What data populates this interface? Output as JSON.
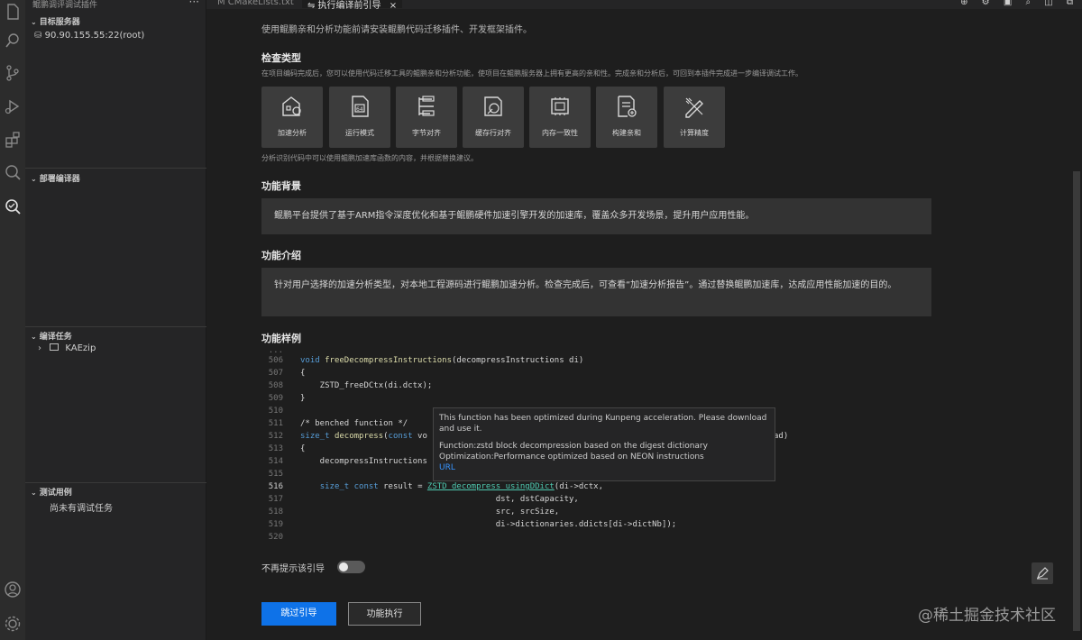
{
  "sidebar": {
    "title": "鲲鹏调评调试插件",
    "more": "···",
    "target_server_section": "目标服务器",
    "server_item": "90.90.155.55:22(root)",
    "deploy_section": "部署编译器",
    "compile_section": "编译任务",
    "compile_item": "KAEzip",
    "test_section": "测试用例",
    "test_empty": "尚未有调试任务"
  },
  "tabs": [
    {
      "label": "M CMakeLists.txt"
    },
    {
      "label": "⇋ 执行编译前引导",
      "close": "×"
    }
  ],
  "titlebar_icons": "⊕ ⚙ ▣ ⌕ ◫ ⧉",
  "main": {
    "intro": "使用鲲鹏亲和分析功能前请安装鲲鹏代码迁移插件、开发框架插件。",
    "check_type_title": "检查类型",
    "check_type_desc": "在项目编码完成后，您可以使用代码迁移工具的鲲鹏亲和分析功能，使项目在鲲鹏服务器上拥有更高的亲和性。完成亲和分析后，可回到本插件完成进一步编译调试工作。",
    "cards": [
      {
        "label": "加速分析",
        "icon": "building-gear-icon"
      },
      {
        "label": "运行模式",
        "icon": "document-64-icon"
      },
      {
        "label": "字节对齐",
        "icon": "align-list-icon"
      },
      {
        "label": "缓存行对齐",
        "icon": "gauge-doc-icon"
      },
      {
        "label": "内存一致性",
        "icon": "memory-icon"
      },
      {
        "label": "构建亲和",
        "icon": "doc-add-icon"
      },
      {
        "label": "计算精度",
        "icon": "pencil-ruler-icon"
      }
    ],
    "cards_note": "分析识别代码中可以使用鲲鹏加速库函数的内容，并根据替换建议。",
    "background_title": "功能背景",
    "background_text": "鲲鹏平台提供了基于ARM指令深度优化和基于鲲鹏硬件加速引擎开发的加速库，覆盖众多开发场景，提升用户应用性能。",
    "intro_title": "功能介绍",
    "intro_text": "针对用户选择的加速分析类型，对本地工程源码进行鲲鹏加速分析。检查完成后，可查看“加速分析报告”。通过替换鲲鹏加速库，达成应用性能加速的目的。",
    "example_title": "功能样例",
    "dont_show": "不再提示该引导",
    "skip_button": "跳过引导",
    "run_button": "功能执行"
  },
  "code": {
    "ellipsis": "...",
    "lines": [
      {
        "num": "506",
        "text": "void freeDecompressInstructions(decompressInstructions di)"
      },
      {
        "num": "507",
        "text": "{"
      },
      {
        "num": "508",
        "text": "    ZSTD_freeDCtx(di.dctx);"
      },
      {
        "num": "509",
        "text": "}"
      },
      {
        "num": "510",
        "text": ""
      },
      {
        "num": "511",
        "text": "/* benched function */"
      },
      {
        "num": "512",
        "text": "size_t decompress(const vo"
      },
      {
        "num": "513",
        "text": "{"
      },
      {
        "num": "514",
        "text": "    decompressInstructions"
      },
      {
        "num": "515",
        "text": ""
      },
      {
        "num": "516",
        "text": "    size_t const result = ZSTD_decompress_usingDDict(di->dctx,"
      },
      {
        "num": "517",
        "text": "                                        dst, dstCapacity,"
      },
      {
        "num": "518",
        "text": "                                        src, srcSize,"
      },
      {
        "num": "519",
        "text": "                                        di->dictionaries.ddicts[di->dictNb]);"
      },
      {
        "num": "520",
        "text": ""
      }
    ],
    "tail_512": "ad)"
  },
  "tooltip": {
    "line1": "This function has been optimized during Kunpeng acceleration. Please download and use it.",
    "line2": "Function:zstd block decompression based on the digest dictionary",
    "line3": "Optimization:Performance optimized based on NEON instructions",
    "link": "URL"
  },
  "watermark": "@稀土掘金技术社区",
  "colors": {
    "primary_button": "#0e72e8",
    "background": "#1e1e1e",
    "panel": "#333333"
  }
}
